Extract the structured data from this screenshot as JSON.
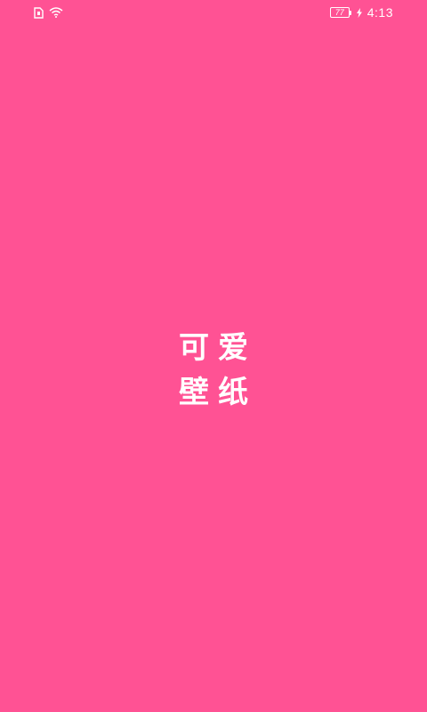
{
  "status_bar": {
    "battery_level": "77",
    "time": "4:13",
    "icons": [
      "sim-card-icon",
      "wifi-icon",
      "battery-icon",
      "charging-bolt-icon"
    ],
    "text_color": "#FFFFFF"
  },
  "splash": {
    "line1": "可爱",
    "line2": "壁纸",
    "background_color": "#FF5294",
    "text_color": "#FFFFFF"
  }
}
